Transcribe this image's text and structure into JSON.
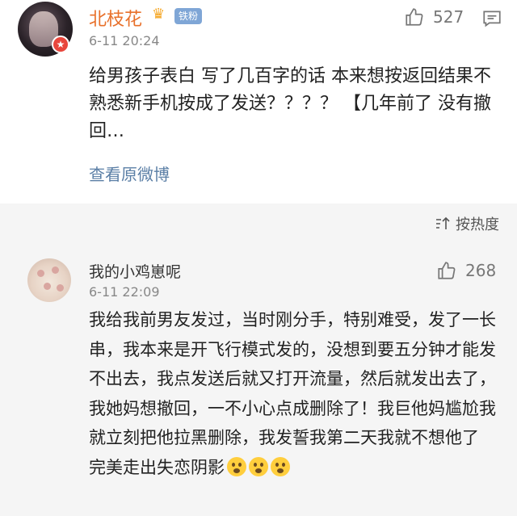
{
  "post": {
    "author": "北枝花",
    "fan_badge": "铁粉",
    "time": "6-11 20:24",
    "like_count": "527",
    "text": "给男孩子表白 写了几百字的话 本来想按返回结果不熟悉新手机按成了发送？？？？ 【几年前了 没有撤回…",
    "view_original": "查看原微博",
    "icons": {
      "like": "thumbs-up-icon",
      "comment": "comment-icon",
      "crown": "crown-icon",
      "verified": "verified-badge-icon"
    }
  },
  "sort": {
    "label": "按热度",
    "icon": "sort-icon"
  },
  "reply": {
    "author": "我的小鸡崽呢",
    "time": "6-11 22:09",
    "like_count": "268",
    "text": "我给我前男友发过，当时刚分手，特别难受，发了一长串，我本来是开飞行模式发的，没想到要五分钟才能发不出去，我点发送后就又打开流量，然后就发出去了，我她妈想撤回，一不小心点成删除了！我巨他妈尴尬我就立刻把他拉黑删除，我发誓我第二天我就不想他了 完美走出失恋阴影",
    "emoji_count": 3,
    "emoji_icon": "scared-face-emoji-icon"
  }
}
